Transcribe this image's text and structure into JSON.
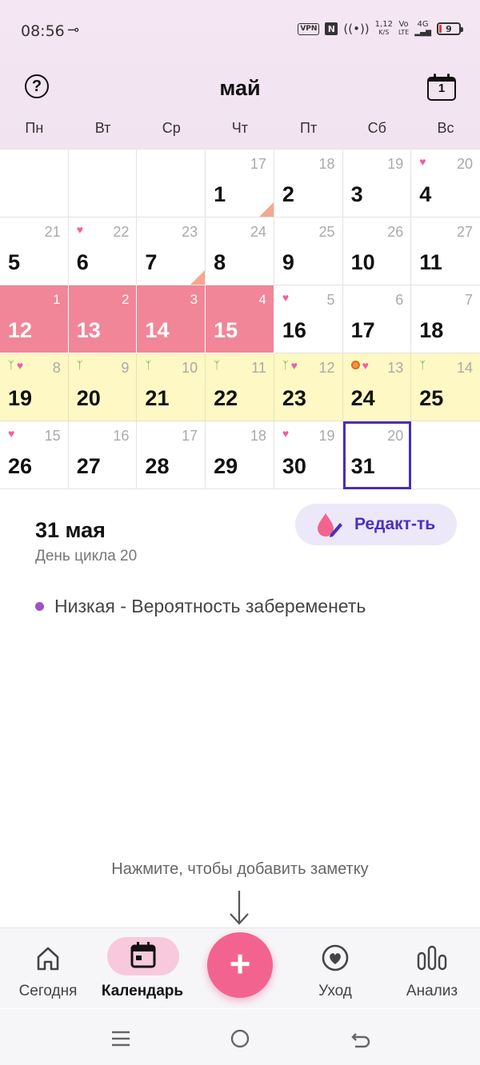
{
  "status_bar": {
    "time": "08:56",
    "vpn": "VPN",
    "nfc": "N",
    "net_speed_top": "1,12",
    "net_speed_bottom": "K/S",
    "volte_top": "Vo",
    "volte_bottom": "LTE",
    "network": "4G",
    "battery": "9"
  },
  "header": {
    "help_label": "?",
    "month": "май",
    "today_number": "1"
  },
  "weekdays": [
    "Пн",
    "Вт",
    "Ср",
    "Чт",
    "Пт",
    "Сб",
    "Вс"
  ],
  "calendar": {
    "weeks": [
      [
        {
          "day": "",
          "cycle": "",
          "type": "empty"
        },
        {
          "day": "",
          "cycle": "",
          "type": "empty"
        },
        {
          "day": "",
          "cycle": "",
          "type": "empty"
        },
        {
          "day": "1",
          "cycle": "17",
          "type": "normal",
          "icons": [],
          "corner": true
        },
        {
          "day": "2",
          "cycle": "18",
          "type": "normal",
          "icons": []
        },
        {
          "day": "3",
          "cycle": "19",
          "type": "normal",
          "icons": []
        },
        {
          "day": "4",
          "cycle": "20",
          "type": "normal",
          "icons": [
            "heart"
          ]
        }
      ],
      [
        {
          "day": "5",
          "cycle": "21",
          "type": "normal",
          "icons": []
        },
        {
          "day": "6",
          "cycle": "22",
          "type": "normal",
          "icons": [
            "heart"
          ]
        },
        {
          "day": "7",
          "cycle": "23",
          "type": "normal",
          "icons": [],
          "corner": true
        },
        {
          "day": "8",
          "cycle": "24",
          "type": "normal",
          "icons": []
        },
        {
          "day": "9",
          "cycle": "25",
          "type": "normal",
          "icons": []
        },
        {
          "day": "10",
          "cycle": "26",
          "type": "normal",
          "icons": []
        },
        {
          "day": "11",
          "cycle": "27",
          "type": "normal",
          "icons": []
        }
      ],
      [
        {
          "day": "12",
          "cycle": "1",
          "type": "period",
          "icons": []
        },
        {
          "day": "13",
          "cycle": "2",
          "type": "period",
          "icons": []
        },
        {
          "day": "14",
          "cycle": "3",
          "type": "period",
          "icons": []
        },
        {
          "day": "15",
          "cycle": "4",
          "type": "period",
          "icons": []
        },
        {
          "day": "16",
          "cycle": "5",
          "type": "normal",
          "icons": [
            "heart"
          ]
        },
        {
          "day": "17",
          "cycle": "6",
          "type": "normal",
          "icons": []
        },
        {
          "day": "18",
          "cycle": "7",
          "type": "normal",
          "icons": []
        }
      ],
      [
        {
          "day": "19",
          "cycle": "8",
          "type": "fertile",
          "icons": [
            "sprout",
            "heart"
          ]
        },
        {
          "day": "20",
          "cycle": "9",
          "type": "fertile",
          "icons": [
            "sprout"
          ]
        },
        {
          "day": "21",
          "cycle": "10",
          "type": "fertile",
          "icons": [
            "sprout"
          ]
        },
        {
          "day": "22",
          "cycle": "11",
          "type": "fertile",
          "icons": [
            "sprout"
          ]
        },
        {
          "day": "23",
          "cycle": "12",
          "type": "fertile",
          "icons": [
            "sprout",
            "heart"
          ]
        },
        {
          "day": "24",
          "cycle": "13",
          "type": "fertile",
          "icons": [
            "egg",
            "heart"
          ]
        },
        {
          "day": "25",
          "cycle": "14",
          "type": "fertile",
          "icons": [
            "sprout"
          ]
        }
      ],
      [
        {
          "day": "26",
          "cycle": "15",
          "type": "normal",
          "icons": [
            "heart"
          ]
        },
        {
          "day": "27",
          "cycle": "16",
          "type": "normal",
          "icons": []
        },
        {
          "day": "28",
          "cycle": "17",
          "type": "normal",
          "icons": []
        },
        {
          "day": "29",
          "cycle": "18",
          "type": "normal",
          "icons": []
        },
        {
          "day": "30",
          "cycle": "19",
          "type": "normal",
          "icons": [
            "heart"
          ]
        },
        {
          "day": "31",
          "cycle": "20",
          "type": "normal",
          "icons": [],
          "selected": true
        },
        {
          "day": "",
          "cycle": "",
          "type": "empty"
        }
      ]
    ]
  },
  "detail": {
    "date": "31 мая",
    "cycle_day": "День цикла 20",
    "edit_label": "Редакт-ть",
    "probability": "Низкая - Вероятность забеременеть"
  },
  "note_hint": "Нажмите, чтобы добавить заметку",
  "bottom_nav": {
    "today": "Сегодня",
    "calendar": "Календарь",
    "add": "+",
    "care": "Уход",
    "analysis": "Анализ"
  },
  "colors": {
    "period": "#f08697",
    "fertile": "#fdf8c4",
    "accent": "#4b2fc2",
    "fab": "#f2648f",
    "heart": "#f25ca0",
    "sprout": "#5aa23c"
  }
}
